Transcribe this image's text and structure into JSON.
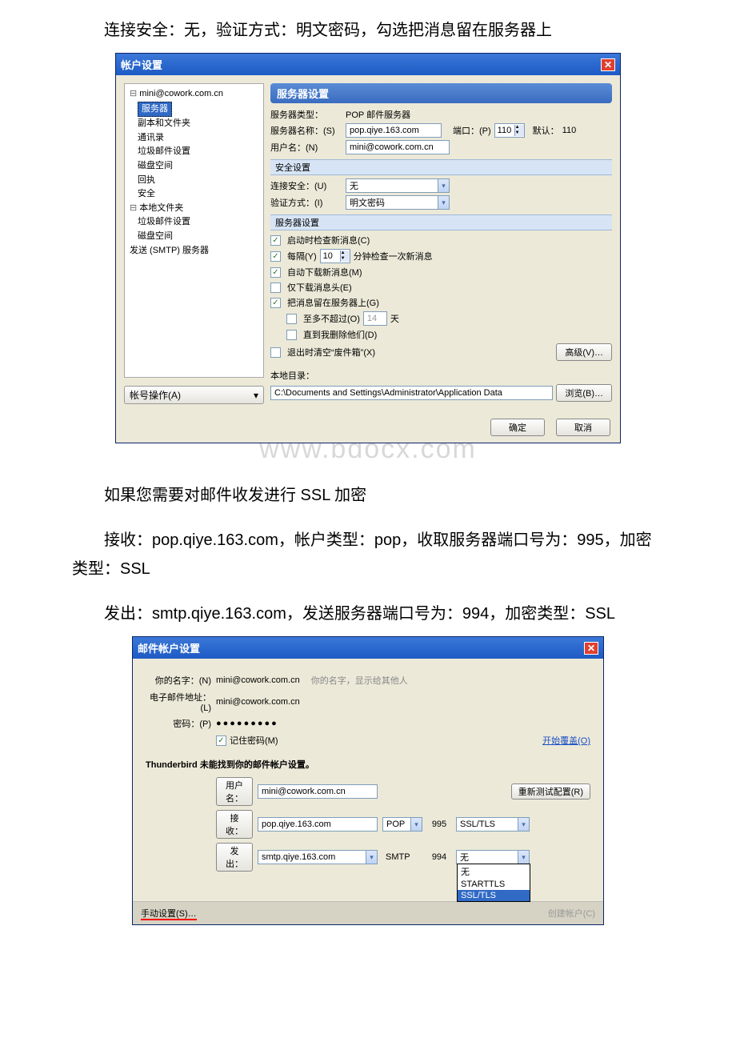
{
  "instructions": {
    "line1": "连接安全：无，验证方式：明文密码，勾选把消息留在服务器上",
    "line2": "如果您需要对邮件收发进行 SSL 加密",
    "line3": "接收：pop.qiye.163.com，帐户类型：pop，收取服务器端口号为：995，加密类型：SSL",
    "line4": "发出：smtp.qiye.163.com，发送服务器端口号为：994，加密类型：SSL"
  },
  "watermark": "www.bdocx.com",
  "win1": {
    "title": "帐户设置",
    "tree": {
      "root": "mini@cowork.com.cn",
      "selected": "服务器",
      "items": [
        "副本和文件夹",
        "通讯录",
        "垃圾邮件设置",
        "磁盘空间",
        "回执",
        "安全"
      ],
      "root2": "本地文件夹",
      "items2": [
        "垃圾邮件设置",
        "磁盘空间"
      ],
      "smtp": "发送 (SMTP) 服务器"
    },
    "header": "服务器设置",
    "server_type_lbl": "服务器类型：",
    "server_type": "POP 邮件服务器",
    "server_name_lbl": "服务器名称：(S)",
    "server_name": "pop.qiye.163.com",
    "port_lbl": "端口：(P)",
    "port": "110",
    "default_lbl": "默认：",
    "default_val": "110",
    "user_lbl": "用户名：(N)",
    "user": "mini@cowork.com.cn",
    "sec_header": "安全设置",
    "conn_lbl": "连接安全：(U)",
    "conn_val": "无",
    "auth_lbl": "验证方式：(I)",
    "auth_val": "明文密码",
    "srv_header": "服务器设置",
    "chk_startup": "启动时检查新消息(C)",
    "chk_every_pre": "每隔(Y)",
    "chk_every_val": "10",
    "chk_every_post": "分钟检查一次新消息",
    "chk_download": "自动下载新消息(M)",
    "chk_headers": "仅下载消息头(E)",
    "chk_leave": "把消息留在服务器上(G)",
    "chk_atmost_pre": "至多不超过(O)",
    "chk_atmost_val": "14",
    "chk_atmost_post": "天",
    "chk_until": "直到我删除他们(D)",
    "chk_empty": "退出时清空“废件箱”(X)",
    "btn_adv": "高级(V)…",
    "local_dir_lbl": "本地目录：",
    "local_dir": "C:\\Documents and Settings\\Administrator\\Application Data",
    "btn_browse": "浏览(B)…",
    "acct_op": "帐号操作(A)",
    "ok": "确定",
    "cancel": "取消"
  },
  "win2": {
    "title": "邮件帐户设置",
    "name_lbl": "你的名字：(N)",
    "name": "mini@cowork.com.cn",
    "name_hint": "你的名字，显示给其他人",
    "email_lbl": "电子邮件地址：(L)",
    "email": "mini@cowork.com.cn",
    "pwd_lbl": "密码：(P)",
    "pwd": "●●●●●●●●●",
    "remember": "记住密码(M)",
    "start_over": "开始覆盖(O)",
    "error": "Thunderbird 未能找到你的邮件帐户设置。",
    "user_lbl": "用户名：",
    "user": "mini@cowork.com.cn",
    "retest": "重新测试配置(R)",
    "in_lbl": "接收：",
    "in_server": "pop.qiye.163.com",
    "in_proto": "POP",
    "in_port": "995",
    "in_sec": "SSL/TLS",
    "out_lbl": "发出：",
    "out_server": "smtp.qiye.163.com",
    "out_proto": "SMTP",
    "out_port": "994",
    "ssl_options": [
      "无",
      "STARTTLS",
      "SSL/TLS"
    ],
    "manual": "手动设置(S)…",
    "create": "创建帐户(C)"
  }
}
